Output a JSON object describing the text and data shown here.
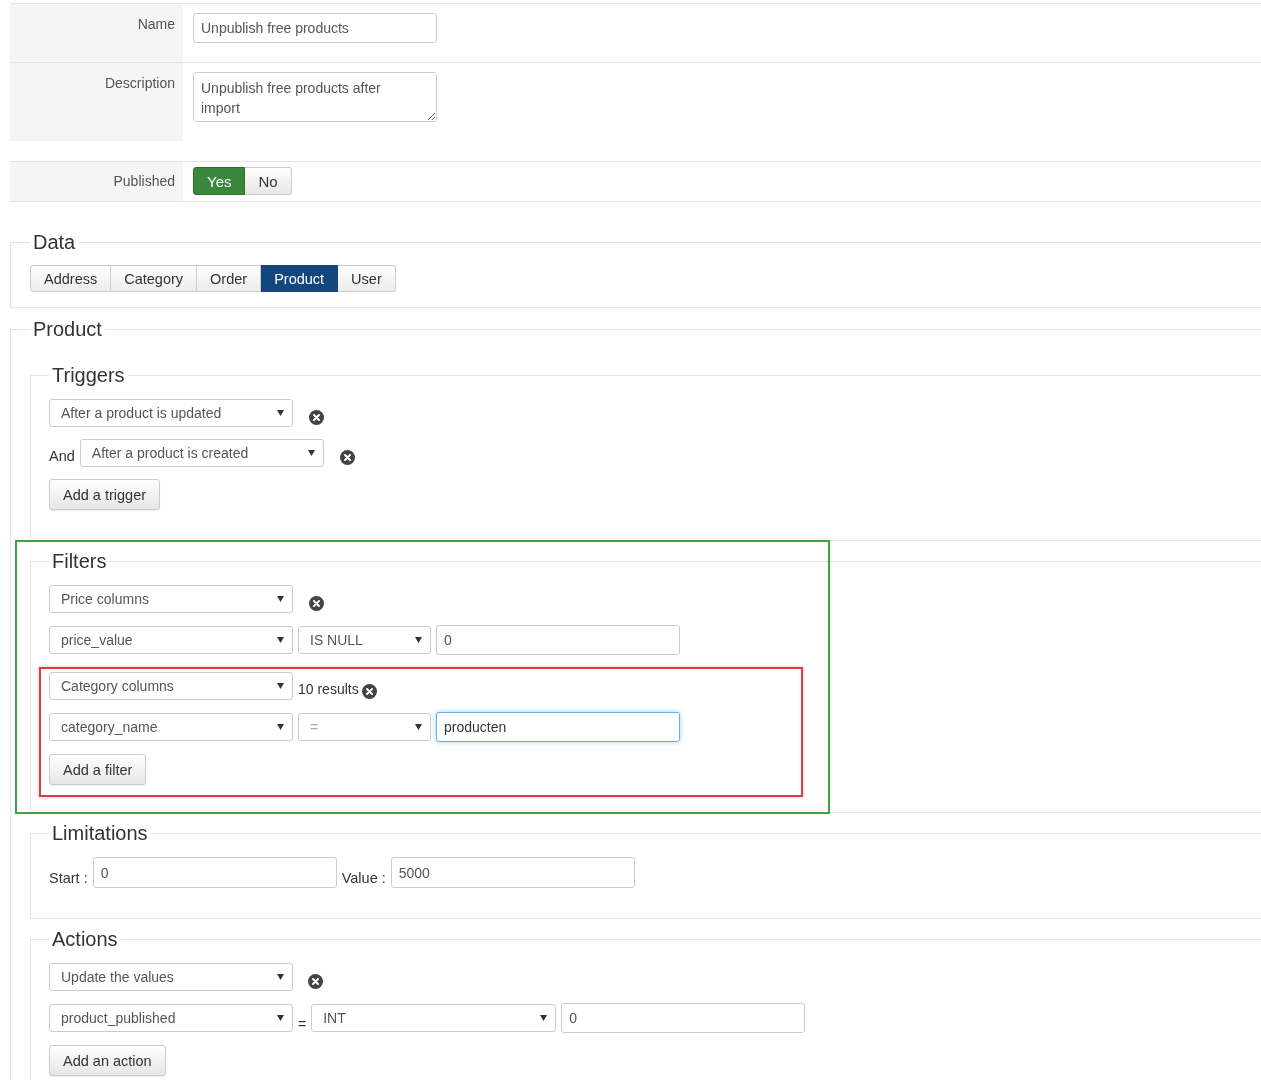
{
  "form": [
    {
      "kind": "input",
      "label": "Name",
      "value": "Unpublish free products"
    },
    {
      "kind": "textarea",
      "label": "Description",
      "value": "Unpublish free products after import"
    },
    {
      "kind": "toggle",
      "label": "Published",
      "options": [
        {
          "label": "Yes",
          "selected": true
        },
        {
          "label": "No",
          "selected": false
        }
      ]
    }
  ],
  "data": {
    "title": "Data",
    "tabs": [
      {
        "label": "Address",
        "selected": false
      },
      {
        "label": "Category",
        "selected": false
      },
      {
        "label": "Order",
        "selected": false
      },
      {
        "label": "Product",
        "selected": true
      },
      {
        "label": "User",
        "selected": false
      }
    ]
  },
  "product": {
    "title": "Product",
    "triggers": {
      "title": "Triggers",
      "rows": [
        {
          "value": "After a product is updated"
        },
        {
          "prefix": "And",
          "value": "After a product is created"
        }
      ],
      "add_button": "Add a trigger"
    },
    "filters": {
      "title": "Filters",
      "highlighted": true,
      "groups": [
        {
          "type": "Price columns",
          "column": "price_value",
          "operator": "IS NULL",
          "value": "0",
          "focused": false,
          "highlighted": false
        },
        {
          "type": "Category columns",
          "results": "10 results",
          "column": "category_name",
          "operator": "=",
          "value": "producten",
          "focused": true,
          "highlighted": true
        }
      ],
      "add_button": "Add a filter"
    },
    "limitations": {
      "title": "Limitations",
      "fields": [
        {
          "label": "Start :",
          "value": "0"
        },
        {
          "label": "Value :",
          "value": "5000"
        }
      ]
    },
    "actions": {
      "title": "Actions",
      "action": "Update the values",
      "column": "product_published",
      "equals": "=",
      "type": "INT",
      "value": "0",
      "add_button": "Add an action"
    }
  }
}
